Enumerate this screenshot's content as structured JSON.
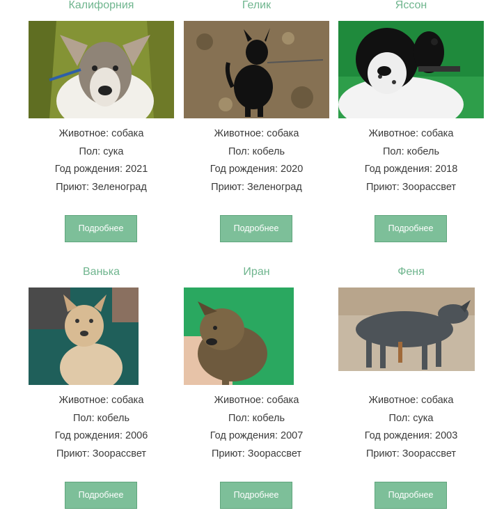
{
  "pets": [
    {
      "name": "Калифорния",
      "animal": "Животное: собака",
      "sex": "Пол: сука",
      "year": "Год рождения: 2021",
      "shelter": "Приют: Зеленоград",
      "button": "Подробнее",
      "photo_desc": "white-brown puppy on grass"
    },
    {
      "name": "Гелик",
      "animal": "Животное: собака",
      "sex": "Пол: кобель",
      "year": "Год рождения: 2020",
      "shelter": "Приют: Зеленоград",
      "button": "Подробнее",
      "photo_desc": "black dog sitting on leaves"
    },
    {
      "name": "Яссон",
      "animal": "Животное: собака",
      "sex": "Пол: кобель",
      "year": "Год рождения: 2018",
      "shelter": "Приют: Зоорассвет",
      "button": "Подробнее",
      "photo_desc": "black and white dog on grass"
    },
    {
      "name": "Ванька",
      "animal": "Животное: собака",
      "sex": "Пол: кобель",
      "year": "Год рождения: 2006",
      "shelter": "Приют: Зоорассвет",
      "button": "Подробнее",
      "photo_desc": "tan puppy on teal blanket"
    },
    {
      "name": "Иран",
      "animal": "Животное: собака",
      "sex": "Пол: кобель",
      "year": "Год рождения: 2007",
      "shelter": "Приют: Зоорассвет",
      "button": "Подробнее",
      "photo_desc": "brindle puppy on green background"
    },
    {
      "name": "Феня",
      "animal": "Животное: собака",
      "sex": "Пол: сука",
      "year": "Год рождения: 2003",
      "shelter": "Приют: Зоорассвет",
      "button": "Подробнее",
      "photo_desc": "gray dog standing on sand"
    }
  ],
  "colors": {
    "accent": "#6fb58e",
    "button": "#7dbf99",
    "text": "#3a3a3a"
  }
}
